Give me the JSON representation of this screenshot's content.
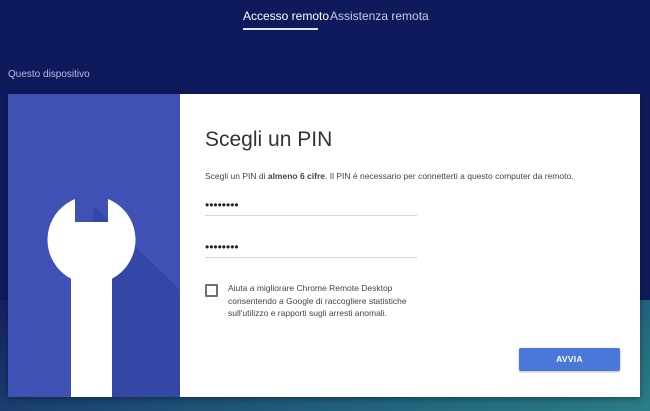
{
  "header": {
    "tabs": [
      {
        "label": "Accesso remoto",
        "active": true
      },
      {
        "label": "Assistenza remota",
        "active": false
      }
    ]
  },
  "section": {
    "label": "Questo dispositivo"
  },
  "dialog": {
    "title": "Scegli un PIN",
    "description": {
      "prefix": "Scegli un PIN di ",
      "bold": "almeno 6 cifre",
      "suffix": ". Il PIN è necessario per connetterti a questo computer da remoto."
    },
    "pin": {
      "value": "••••••••"
    },
    "pin_confirm": {
      "value": "••••••••"
    },
    "checkbox": {
      "checked": false,
      "label": "Aiuta a migliorare Chrome Remote Desktop consentendo a Google di raccogliere statistiche sull'utilizzo e rapporti sugli arresti anomali."
    },
    "start_button": {
      "label": "AVVIA"
    }
  },
  "colors": {
    "background": "#0f1a5c",
    "illustration": "#3f51b5",
    "accent_button": "#4a78d8"
  },
  "icons": {
    "illustration": "wrench-icon"
  }
}
